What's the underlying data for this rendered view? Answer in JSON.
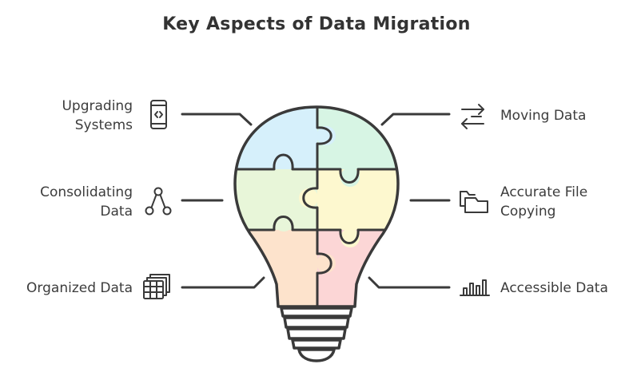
{
  "title": "Key Aspects of Data Migration",
  "aspects": {
    "upgrading_systems": {
      "line1": "Upgrading",
      "line2": "Systems",
      "icon": "mobile-code-icon"
    },
    "consolidating_data": {
      "line1": "Consolidating",
      "line2": "Data",
      "icon": "hierarchy-icon"
    },
    "organized_data": {
      "line1": "Organized Data",
      "icon": "table-stack-icon"
    },
    "moving_data": {
      "line1": "Moving Data",
      "icon": "transfer-arrows-icon"
    },
    "accurate_file_copying": {
      "line1": "Accurate File",
      "line2": "Copying",
      "icon": "folders-icon"
    },
    "accessible_data": {
      "line1": "Accessible Data",
      "icon": "bar-chart-icon"
    }
  },
  "colors": {
    "piece_top_left": "#d6f0fb",
    "piece_top_right": "#d7f5e4",
    "piece_mid_left": "#e8f6d9",
    "piece_mid_right": "#fdf8cf",
    "piece_bottom_left": "#fde3cc",
    "piece_bottom_right": "#fcd6d6",
    "stroke": "#3a3a3a"
  }
}
